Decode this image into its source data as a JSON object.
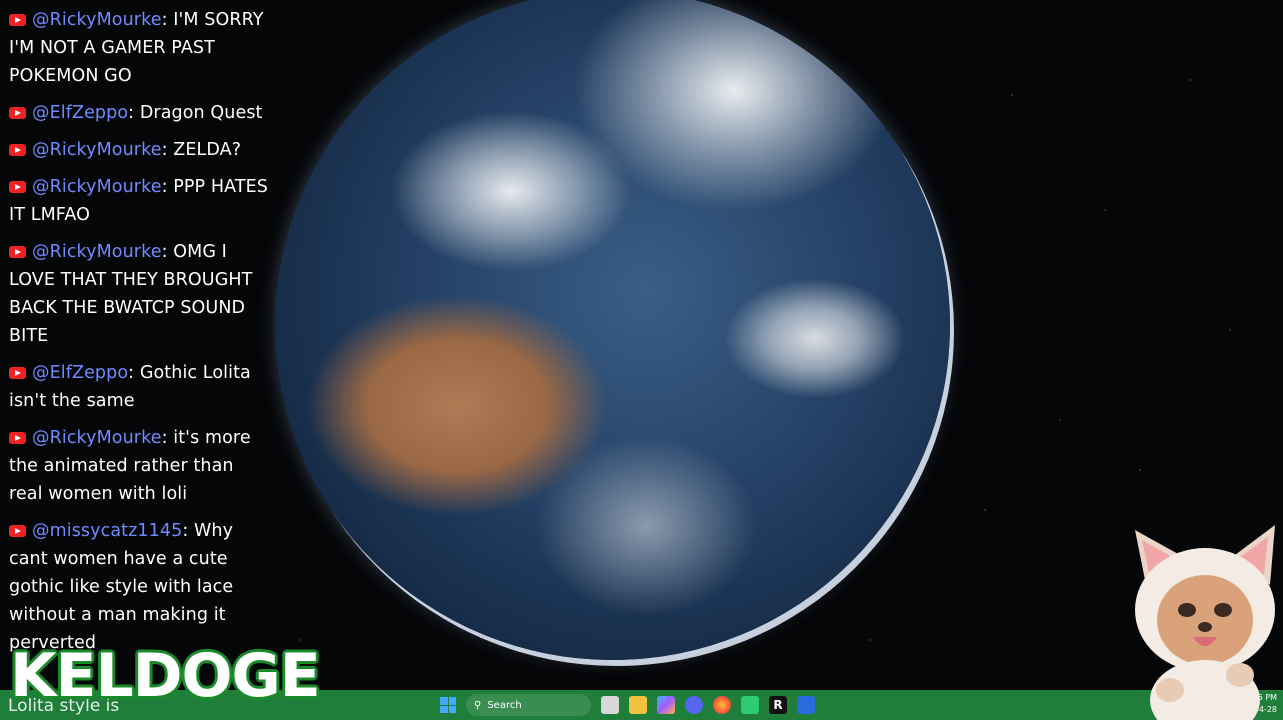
{
  "chat": {
    "messages": [
      {
        "user": "@RickyMourke",
        "sep": ":",
        "text": " I'M SORRY I'M NOT A GAMER PAST POKEMON GO"
      },
      {
        "user": "@ElfZeppo",
        "sep": ":",
        "text": " Dragon Quest"
      },
      {
        "user": "@RickyMourke",
        "sep": ":",
        "text": " ZELDA?"
      },
      {
        "user": "@RickyMourke",
        "sep": ":",
        "text": " PPP HATES IT LMFAO"
      },
      {
        "user": "@RickyMourke",
        "sep": ":",
        "text": " OMG I LOVE THAT THEY BROUGHT BACK THE BWATCP SOUND BITE"
      },
      {
        "user": "@ElfZeppo",
        "sep": ":",
        "text": " Gothic Lolita isn't the same"
      },
      {
        "user": "@RickyMourke",
        "sep": ":",
        "text": " it's more the animated rather than real women with loli"
      },
      {
        "user": "@missycatz1145",
        "sep": ":",
        "text": " Why cant women have a cute gothic like style with lace without a man making it perverted"
      }
    ],
    "partial_line": "Lolita style is"
  },
  "overlay": {
    "logo_text": "KELDOGE"
  },
  "taskbar": {
    "search_label": "Search",
    "tray_time": "5:56 PM",
    "tray_date": "2024-04-28"
  },
  "colors": {
    "username": "#6f8cff",
    "taskbar": "#1f7e3a",
    "logo_outline": "#1a8a2a"
  }
}
